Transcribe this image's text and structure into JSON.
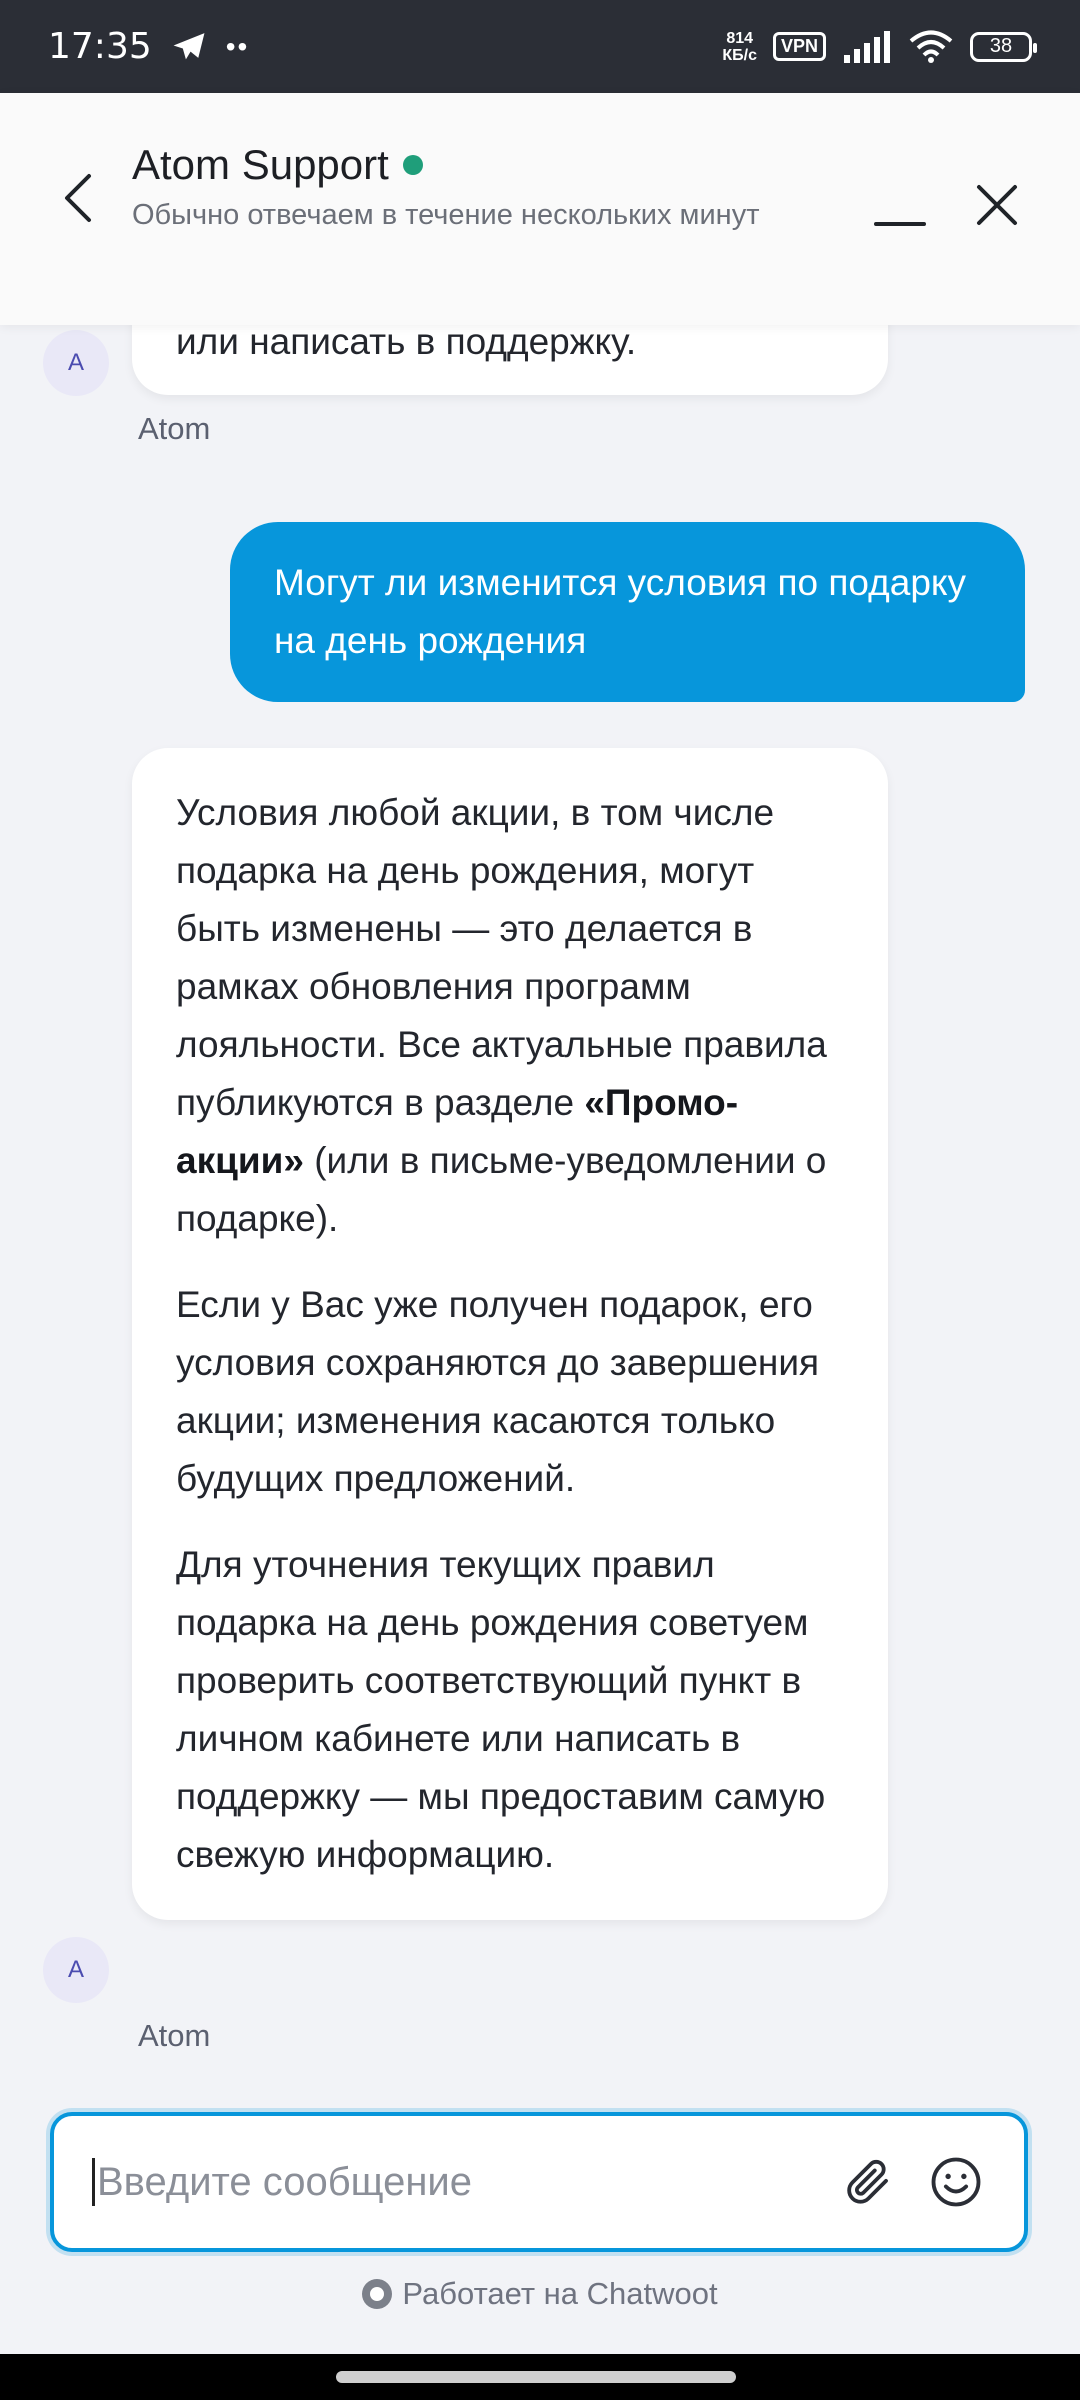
{
  "status_bar": {
    "time": "17:35",
    "speed_value": "814",
    "speed_unit": "КБ/с",
    "vpn": "VPN",
    "battery": "38"
  },
  "header": {
    "title": "Atom Support",
    "subtitle": "Обычно отвечаем в течение нескольких минут"
  },
  "messages": {
    "partial_incoming": "или написать в поддержку.",
    "partial_sender": "Atom",
    "outgoing": "Могут ли изменится условия по подарку на день рождения",
    "reply": {
      "p1_before": "Условия любой акции, в том числе подарка на день рождения, могут быть изменены — это делается в рамках обновления программ лояльности. Все актуальные правила публикуются в разделе ",
      "p1_bold": "«Промо-акции»",
      "p1_after": " (или в письме-уведомлении о подарке).",
      "p2": "Если у Вас уже получен подарок, его условия сохраняются до завершения акции; изменения касаются только будущих предложений.",
      "p3": "Для уточнения текущих правил подарка на день рождения советуем проверить соответствующий пункт в личном кабинете или написать в поддержку — мы предоставим самую свежую информацию."
    },
    "reply_sender": "Atom",
    "avatar_letter": "A"
  },
  "composer": {
    "placeholder": "Введите сообщение",
    "value": ""
  },
  "footer": {
    "powered_by": "Работает на Chatwoot"
  },
  "colors": {
    "accent": "#0796db",
    "online": "#1f9e7a",
    "background": "#f2f3f7"
  },
  "icons": [
    "back-arrow-icon",
    "minimize-icon",
    "close-icon",
    "attachment-icon",
    "emoji-icon",
    "chatwoot-logo-icon",
    "telegram-icon",
    "wifi-icon",
    "signal-icon",
    "battery-icon"
  ]
}
